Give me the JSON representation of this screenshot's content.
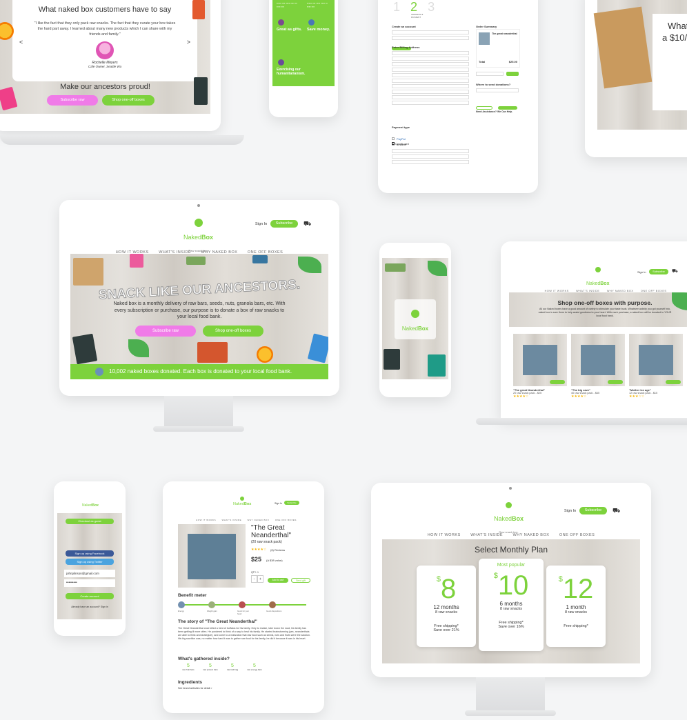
{
  "testimonial": {
    "title": "What naked box customers have to say",
    "quote": "\"I like the fact that they only pack raw snacks. The fact that they curate your box takes the hard part away. I learned about many new products which I can share with my friends and family.\"",
    "author": "Rochelle Meyers",
    "role": "Cafe Owner, Seattle Wa",
    "prev": "<",
    "next": ">",
    "cta_title": "Make our ancestors proud!",
    "subscribe": "Subscribe raw",
    "shop": "Shop one-off boxes"
  },
  "benefits": {
    "great_gift": "Great as gifts.",
    "save_money": "Save money.",
    "exercising": "Exercising our humanitarianism."
  },
  "checkout": {
    "steps": [
      "1",
      "2",
      "3"
    ],
    "step_label": "ADDRESS & PAYMENT",
    "create_account": "Create an account",
    "billing": "Enter Billing Address",
    "order_summary": "Order Summary",
    "product": "The great neanderthal",
    "total_label": "Total",
    "total_value": "$25.00",
    "donations": "Where to send donations?",
    "assistance": "Need Assistance? We Can Help.",
    "payment_type": "Payment type",
    "credit_card": "Credit card"
  },
  "gift_box": {
    "line1": "What",
    "line2": "a $10/"
  },
  "brand": {
    "name_part1": "Naked",
    "name_part2": "Box",
    "tagline": "Raw snack box."
  },
  "header": {
    "sign_in": "Sign In",
    "subscribe": "Subscribe",
    "nav": [
      "HOW IT WORKS",
      "WHAT'S INSIDE",
      "WHY NAKED BOX",
      "ONE OFF BOXES"
    ]
  },
  "hero": {
    "headline": "SNACK LIKE OUR ANCESTORS.",
    "body": "Naked box is a monthly delivery of raw bars, seeds, nuts, granola bars, etc. With every subscription or purchase, our purpose is to donate a box of raw snacks to your local food bank.",
    "subscribe": "Subscribe raw",
    "shop": "Shop one-off boxes",
    "banner": "10,002 naked boxes donated. Each box is donated to your local food bank."
  },
  "shop": {
    "title": "Shop one-off boxes with purpose.",
    "subtitle": "All our Naked boxes have a good amount of variety to stimulate your taste buds. Whatever activity you got yourself into, naked box is sure there to help assist goodness to your heart. With each purchase, a naked box will be donated to YOUR local food bank.",
    "products": [
      {
        "name": "\"The great Neanderthal\"",
        "desc": "20 raw snack pack - $25"
      },
      {
        "name": "\"The big cave\"",
        "desc": "40 raw snack pack - $45"
      },
      {
        "name": "\"Mother Ice age\"",
        "desc": "12 raw snack pack - $15"
      }
    ]
  },
  "mobile_login": {
    "continue_guest": "Checkout as guest",
    "facebook": "Sign up using Facebook",
    "twitter": "Sign up using Twitter",
    "email": "johnplinson@gmail.com",
    "password": "•••••••••",
    "create": "Create account",
    "footer": "Already have an account? Sign in"
  },
  "product": {
    "title": "\"The Great Neanderthal\"",
    "subtitle": "(20 raw snack pack)",
    "reviews": "(6) Reviews",
    "price": "$25",
    "value": "(A $38 value)",
    "qty_label": "QTY: 1",
    "minus": "-",
    "plus": "+",
    "add": "Add to cart",
    "gift": "Send gift",
    "benefit_title": "Benefit meter",
    "benefit_labels": [
      "Energy",
      "Weight gain",
      "Good for your heart",
      "Good dispositions"
    ],
    "story_title": "The story of \"The Great Neanderthal\"",
    "story": "The Great Neanderthal once killed a herd of buffalos for his family. Only to realize, later down the road, his family has been getting ill more often. He pondered to think of a way to heal his family. He started brainstorming (yes, neanderthals are able to think and strategize), and come to a realization that raw food such as seeds, nuts and fruits were the solution. His big sacrifice was, no matter how hard it was to gather raw food for his family, he did it because it was in his heart.",
    "gathered_title": "What's gathered inside?",
    "counts": [
      {
        "n": "5",
        "label": "raw fruit bars"
      },
      {
        "n": "5",
        "label": "raw protein bars"
      },
      {
        "n": "5",
        "label": "raw trail bag"
      },
      {
        "n": "5",
        "label": "raw energy bars"
      }
    ],
    "ingredients_title": "Ingredients",
    "ingredients_note": "See brand websites for detail >"
  },
  "plans": {
    "title": "Select Monthly Plan",
    "currency": "$",
    "items": [
      {
        "price": "8",
        "term": "12 months",
        "snacks": "8 raw snacks",
        "ship": "Free shipping*",
        "save": "Save over 21%",
        "badge": ""
      },
      {
        "price": "10",
        "term": "6 months",
        "snacks": "8 raw snacks",
        "ship": "Free shipping*",
        "save": "Save over 16%",
        "badge": "Most popular"
      },
      {
        "price": "12",
        "term": "1 month",
        "snacks": "8 raw snacks",
        "ship": "Free shipping*",
        "save": "",
        "badge": ""
      }
    ]
  },
  "colors": {
    "accent": "#7dd23c",
    "pink": "#f07be8",
    "banner": "#7dd23c"
  }
}
